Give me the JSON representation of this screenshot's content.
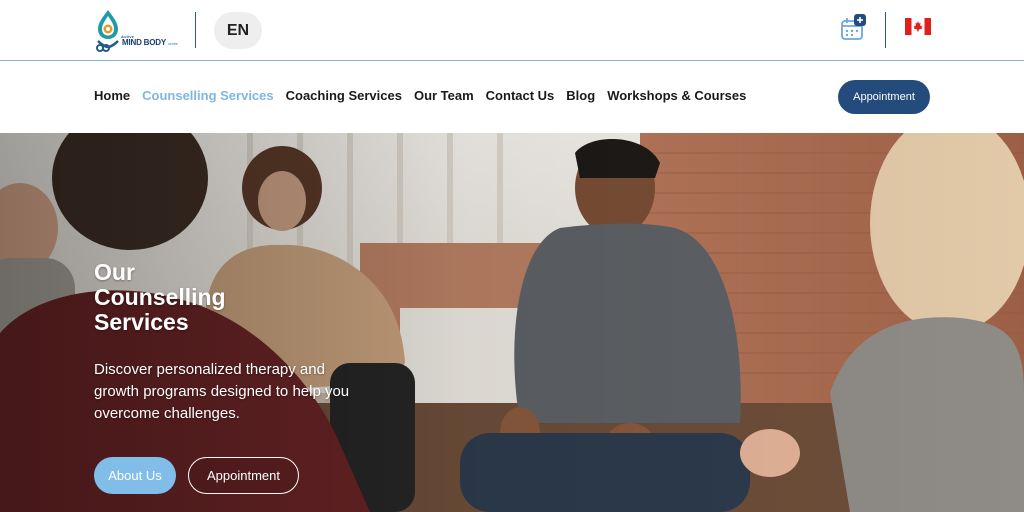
{
  "header": {
    "logo": {
      "small_text": "Active",
      "brand": "MIND BODY",
      "brand_sub": "centre"
    },
    "language": "EN",
    "icons": {
      "calendar": "calendar-plus-icon",
      "flag": "canada-flag-icon"
    },
    "colors": {
      "accent": "#7fb7e3",
      "primary": "#234b7c",
      "divider": "#7fb0d6"
    }
  },
  "nav": {
    "items": [
      {
        "label": "Home",
        "active": false
      },
      {
        "label": "Counselling Services",
        "active": true
      },
      {
        "label": "Coaching Services",
        "active": false
      },
      {
        "label": "Our Team",
        "active": false
      },
      {
        "label": "Contact Us",
        "active": false
      },
      {
        "label": "Blog",
        "active": false
      },
      {
        "label": "Workshops & Courses",
        "active": false
      }
    ],
    "cta_label": "Appointment"
  },
  "hero": {
    "title": "Our\nCounselling\nServices",
    "description": "Discover personalized therapy and growth programs designed to help you overcome challenges.",
    "primary_button": "About Us",
    "secondary_button": "Appointment"
  }
}
